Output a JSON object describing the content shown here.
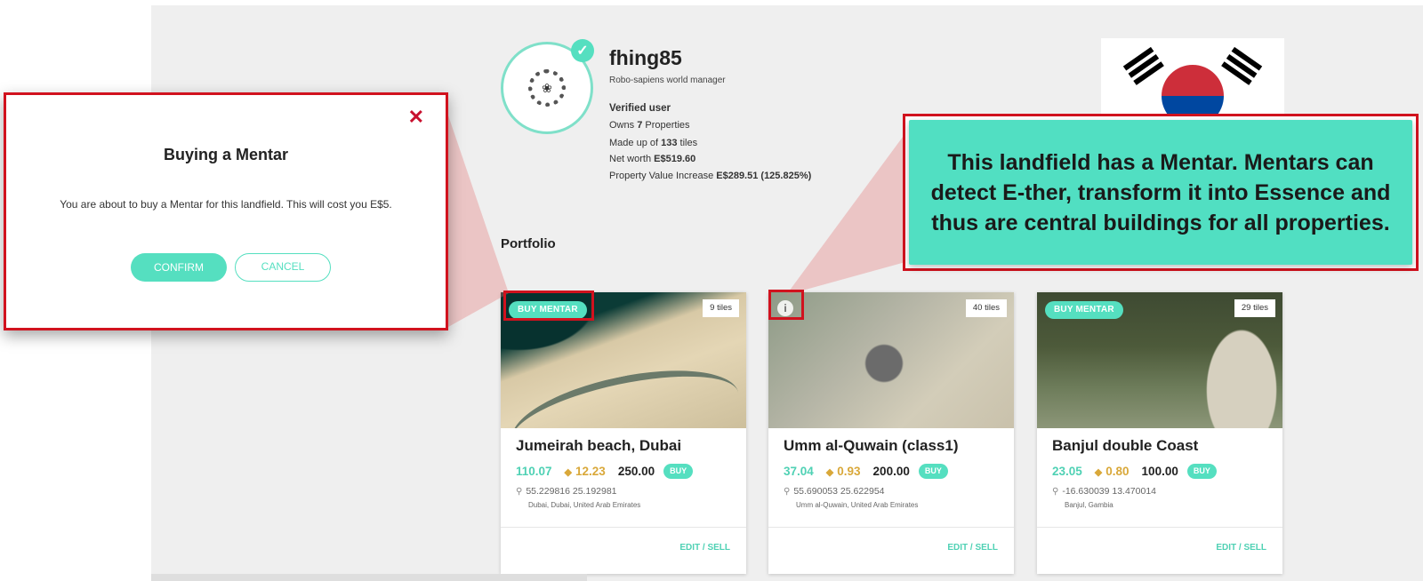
{
  "profile": {
    "username": "fhing85",
    "role": "Robo-sapiens world manager",
    "verified": "Verified user",
    "owns_prefix": "Owns ",
    "owns_value": "7",
    "owns_suffix": " Properties",
    "tiles_prefix": "Made up of ",
    "tiles_value": "133",
    "tiles_suffix": " tiles",
    "networth_prefix": "Net worth ",
    "networth_value": "E$519.60",
    "increase_prefix": "Property Value Increase ",
    "increase_value": "E$289.51 (125.825%)",
    "check_glyph": "✓",
    "avatar_glyph": "❀"
  },
  "portfolio": {
    "title": "Portfolio",
    "cards": [
      {
        "badge": "BUY MENTAR",
        "tiles": "9 tiles",
        "name": "Jumeirah beach, Dubai",
        "price_a": "110.07",
        "price_b": "12.23",
        "price_c": "250.00",
        "buy_label": "BUY",
        "coords": "55.229816 25.192981",
        "location": "Dubai, Dubai, United Arab Emirates",
        "edit_label": "EDIT / SELL"
      },
      {
        "badge": "",
        "tiles": "40 tiles",
        "name": "Umm al-Quwain (class1)",
        "price_a": "37.04",
        "price_b": "0.93",
        "price_c": "200.00",
        "buy_label": "BUY",
        "coords": "55.690053 25.622954",
        "location": "Umm al-Quwain, United Arab Emirates",
        "edit_label": "EDIT / SELL"
      },
      {
        "badge": "BUY MENTAR",
        "tiles": "29 tiles",
        "name": "Banjul double Coast",
        "price_a": "23.05",
        "price_b": "0.80",
        "price_c": "100.00",
        "buy_label": "BUY",
        "coords": "-16.630039 13.470014",
        "location": "Banjul, Gambia",
        "edit_label": "EDIT / SELL"
      }
    ]
  },
  "icons": {
    "coin": "◆",
    "pin": "⚲",
    "info": "i",
    "close": "✕"
  },
  "dialog": {
    "title": "Buying a Mentar",
    "message": "You are about to buy a Mentar for this landfield. This will cost you E$5.",
    "confirm_label": "CONFIRM",
    "cancel_label": "CANCEL"
  },
  "tooltip": {
    "text": "This landfield has a Mentar. Mentars can detect E-ther, transform it into Essence and thus are central buildings for all properties."
  },
  "colors": {
    "accent": "#55dfc0",
    "highlight": "#d1121e",
    "coin": "#d9a83a",
    "tooltip_bg": "#51dfc2"
  }
}
